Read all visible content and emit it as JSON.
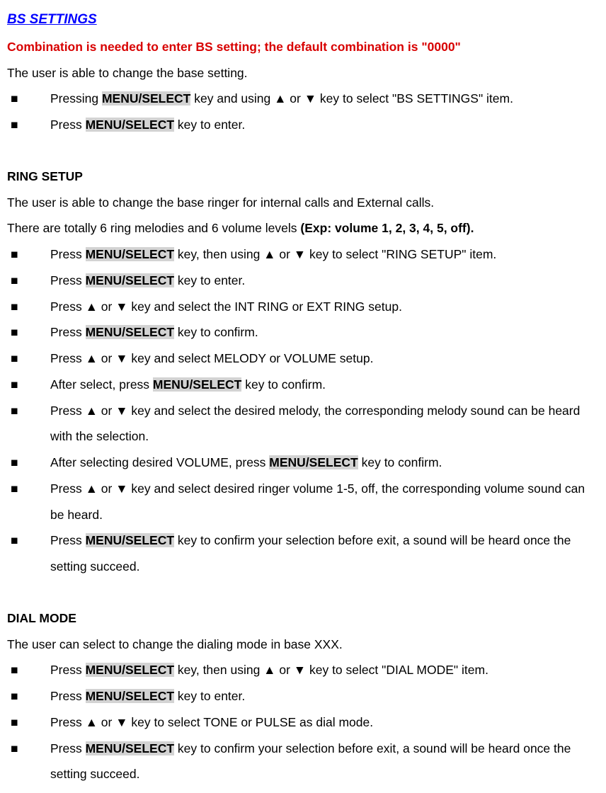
{
  "title": "BS SETTINGS",
  "combination_note": "Combination is needed to enter BS setting; the default combination is \"0000\"",
  "intro": "The user is able to change the base setting.",
  "key_menu_select": "MENU/SELECT",
  "intro_bullets": {
    "b1_a": "Pressing ",
    "b1_b": " key and using ▲ or ▼ key to select \"BS SETTINGS\" item.",
    "b2_a": "Press ",
    "b2_b": " key to enter."
  },
  "ring_setup": {
    "heading": "RING SETUP",
    "line1": "The user is able to change the base ringer for internal calls and External calls.",
    "line2a": "There are totally 6 ring melodies and 6 volume levels ",
    "line2b": "(Exp: volume 1, 2, 3, 4, 5, off).",
    "b1_a": "Press ",
    "b1_b": " key, then using ▲ or ▼ key to select \"RING SETUP\" item.",
    "b2_a": "Press ",
    "b2_b": " key to enter.",
    "b3": "Press ▲ or ▼ key and select the INT RING or EXT RING setup.",
    "b4_a": "Press ",
    "b4_b": " key to confirm.",
    "b5": "Press ▲ or ▼ key and select MELODY or VOLUME setup.",
    "b6_a": "After select, press ",
    "b6_b": " key to confirm.",
    "b7": "Press ▲ or ▼ key and select the desired melody, the corresponding melody sound can be heard with the selection.",
    "b8_a": "After selecting desired VOLUME, press ",
    "b8_b": " key to confirm.",
    "b9": "Press ▲ or ▼ key and select desired ringer volume 1-5, off, the corresponding volume sound can be heard.",
    "b10_a": "Press ",
    "b10_b": " key to confirm your selection before exit, a sound will be heard once the setting succeed."
  },
  "dial_mode": {
    "heading": "DIAL MODE",
    "line1": "The user can select to change the dialing mode in base XXX.",
    "b1_a": "Press ",
    "b1_b": " key, then using ▲ or ▼ key to select \"DIAL MODE\" item.",
    "b2_a": "Press ",
    "b2_b": " key to enter.",
    "b3": "Press ▲ or ▼ key to select TONE or PULSE as dial mode.",
    "b4_a": "Press ",
    "b4_b": " key to confirm your selection before exit, a sound will be heard once the setting succeed."
  }
}
